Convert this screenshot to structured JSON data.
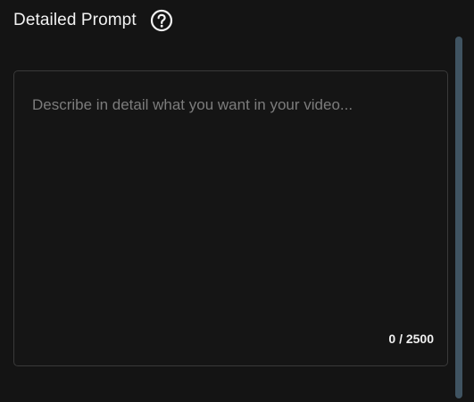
{
  "header": {
    "title": "Detailed Prompt",
    "help_icon": "help-circle-icon"
  },
  "prompt": {
    "value": "",
    "placeholder": "Describe in detail what you want in your video...",
    "char_count": "0 / 2500"
  },
  "colors": {
    "background": "#141414",
    "border": "#3a3a3a",
    "text": "#f2f2f2",
    "placeholder": "#7c7c7c",
    "scrollbar_thumb": "#3f5361"
  }
}
